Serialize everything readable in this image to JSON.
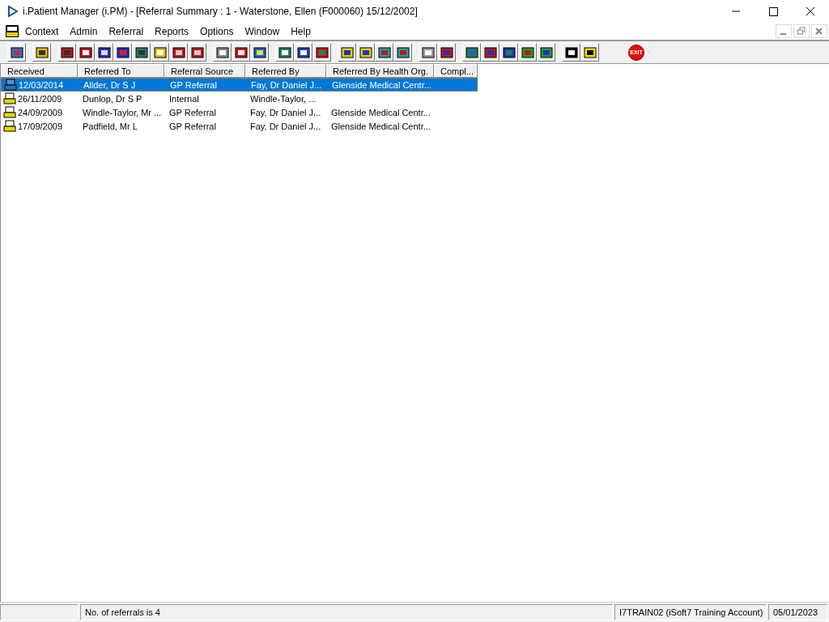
{
  "window": {
    "title": "i.Patient Manager (i.PM) - [Referral Summary : 1 - Waterstone, Ellen (F000060) 15/12/2002]"
  },
  "menu": [
    "Context",
    "Admin",
    "Referral",
    "Reports",
    "Options",
    "Window",
    "Help"
  ],
  "toolbar": {
    "exit_label": "EXIT"
  },
  "table": {
    "columns": [
      "Received",
      "Referred To",
      "Referral Source",
      "Referred By",
      "Referred By Health Org.",
      "Compl..."
    ],
    "rows": [
      {
        "selected": true,
        "cells": [
          "12/03/2014",
          "Allder, Dr S J",
          "GP Referral",
          "Fay, Dr Daniel J...",
          "Glenside Medical Centr..."
        ]
      },
      {
        "selected": false,
        "cells": [
          "26/11/2009",
          "Dunlop, Dr S P",
          "Internal",
          "Windle-Taylor, ..."
        ]
      },
      {
        "selected": false,
        "cells": [
          "24/09/2009",
          "Windle-Taylor, Mr ...",
          "GP Referral",
          "Fay, Dr Daniel J...",
          "Glenside Medical Centr..."
        ]
      },
      {
        "selected": false,
        "cells": [
          "17/09/2009",
          "Padfield, Mr L",
          "GP Referral",
          "Fay, Dr Daniel J...",
          "Glenside Medical Centr..."
        ]
      }
    ]
  },
  "status_bar": [
    "No. of referrals is 4",
    "I7TRAIN02 (iSoft7 Training Account)",
    "05/01/2023"
  ]
}
